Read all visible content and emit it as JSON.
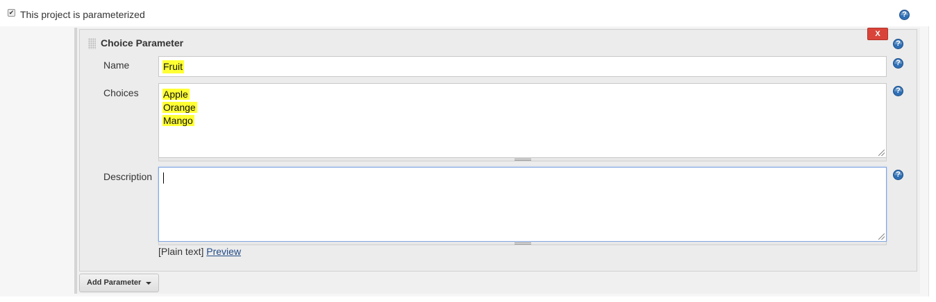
{
  "parameterized": {
    "checked": true,
    "check_glyph": "✔",
    "label": "This project is parameterized"
  },
  "parameter_block": {
    "title": "Choice Parameter",
    "delete_label": "X",
    "fields": {
      "name": {
        "label": "Name",
        "value": "Fruit"
      },
      "choices": {
        "label": "Choices",
        "values": [
          "Apple",
          "Orange",
          "Mango"
        ]
      },
      "description": {
        "label": "Description",
        "value": ""
      }
    },
    "format_hint": "[Plain text]",
    "preview_link": "Preview"
  },
  "add_parameter_button": "Add Parameter",
  "help_glyph": "?",
  "colors": {
    "highlight": "#ffff33",
    "delete_button": "#d9443a",
    "help_icon": "#2f6fb5",
    "link": "#204a87"
  },
  "icons": [
    "checkbox-icon",
    "help-icon",
    "drag-handle-icon",
    "caret-down-icon",
    "resize-grip-icon"
  ]
}
